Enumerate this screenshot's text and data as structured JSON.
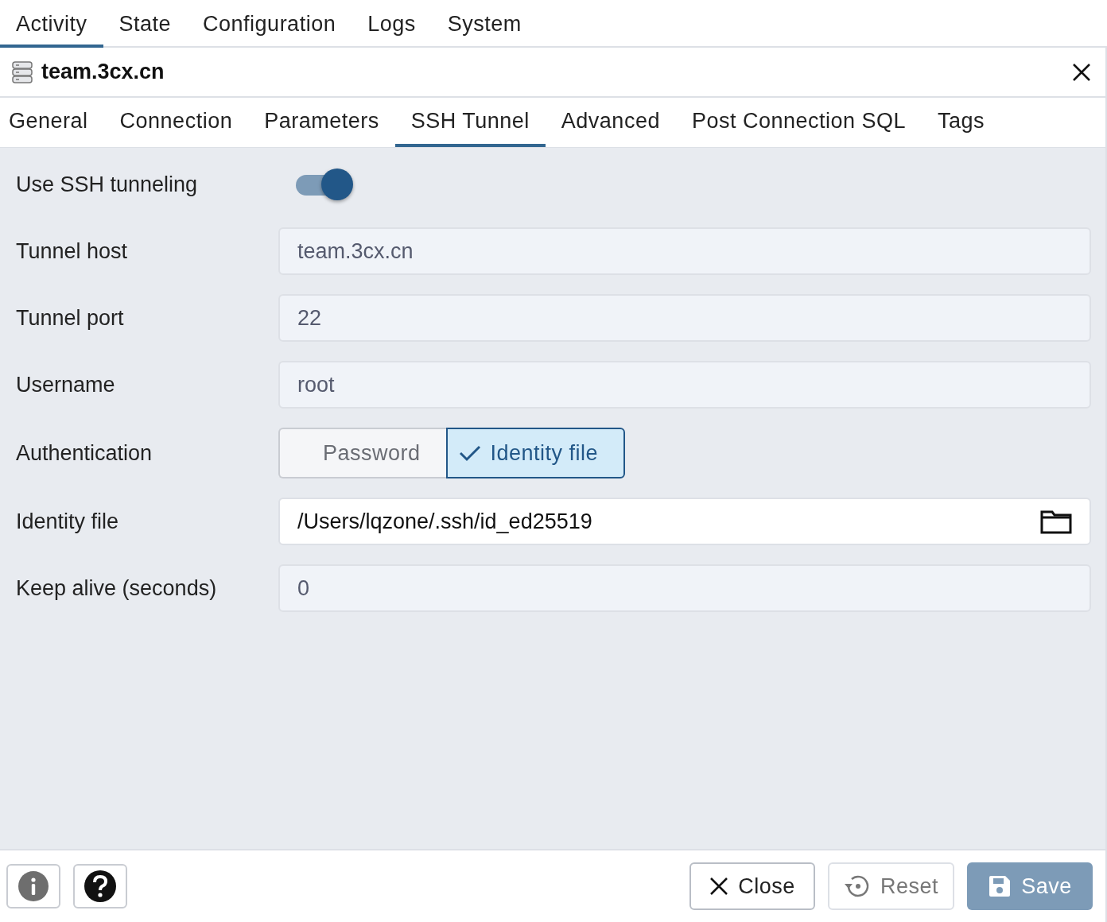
{
  "top_tabs": [
    {
      "label": "Activity",
      "selected": true
    },
    {
      "label": "State",
      "selected": false
    },
    {
      "label": "Configuration",
      "selected": false
    },
    {
      "label": "Logs",
      "selected": false
    },
    {
      "label": "System",
      "selected": false
    }
  ],
  "dialog": {
    "title": "team.3cx.cn",
    "tabs": [
      {
        "label": "General",
        "selected": false
      },
      {
        "label": "Connection",
        "selected": false
      },
      {
        "label": "Parameters",
        "selected": false
      },
      {
        "label": "SSH Tunnel",
        "selected": true
      },
      {
        "label": "Advanced",
        "selected": false
      },
      {
        "label": "Post Connection SQL",
        "selected": false
      },
      {
        "label": "Tags",
        "selected": false
      }
    ],
    "fields": [
      {
        "kind": "toggle",
        "label": "Use SSH tunneling",
        "on": true
      },
      {
        "kind": "text",
        "label": "Tunnel host",
        "value": "team.3cx.cn",
        "disabled": true
      },
      {
        "kind": "text",
        "label": "Tunnel port",
        "value": "22",
        "disabled": true
      },
      {
        "kind": "text",
        "label": "Username",
        "value": "root",
        "disabled": true
      },
      {
        "kind": "segmented",
        "label": "Authentication",
        "options": [
          {
            "label": "Password",
            "selected": false
          },
          {
            "label": "Identity file",
            "selected": true
          }
        ]
      },
      {
        "kind": "file",
        "label": "Identity file",
        "value": "/Users/lqzone/.ssh/id_ed25519",
        "disabled": false
      },
      {
        "kind": "text",
        "label": "Keep alive (seconds)",
        "value": "0",
        "disabled": true
      }
    ],
    "footer": {
      "buttons": [
        {
          "kind": "close",
          "label": "Close",
          "disabled": false
        },
        {
          "kind": "reset",
          "label": "Reset",
          "disabled": true
        },
        {
          "kind": "save",
          "label": "Save",
          "disabled": true
        }
      ]
    }
  }
}
